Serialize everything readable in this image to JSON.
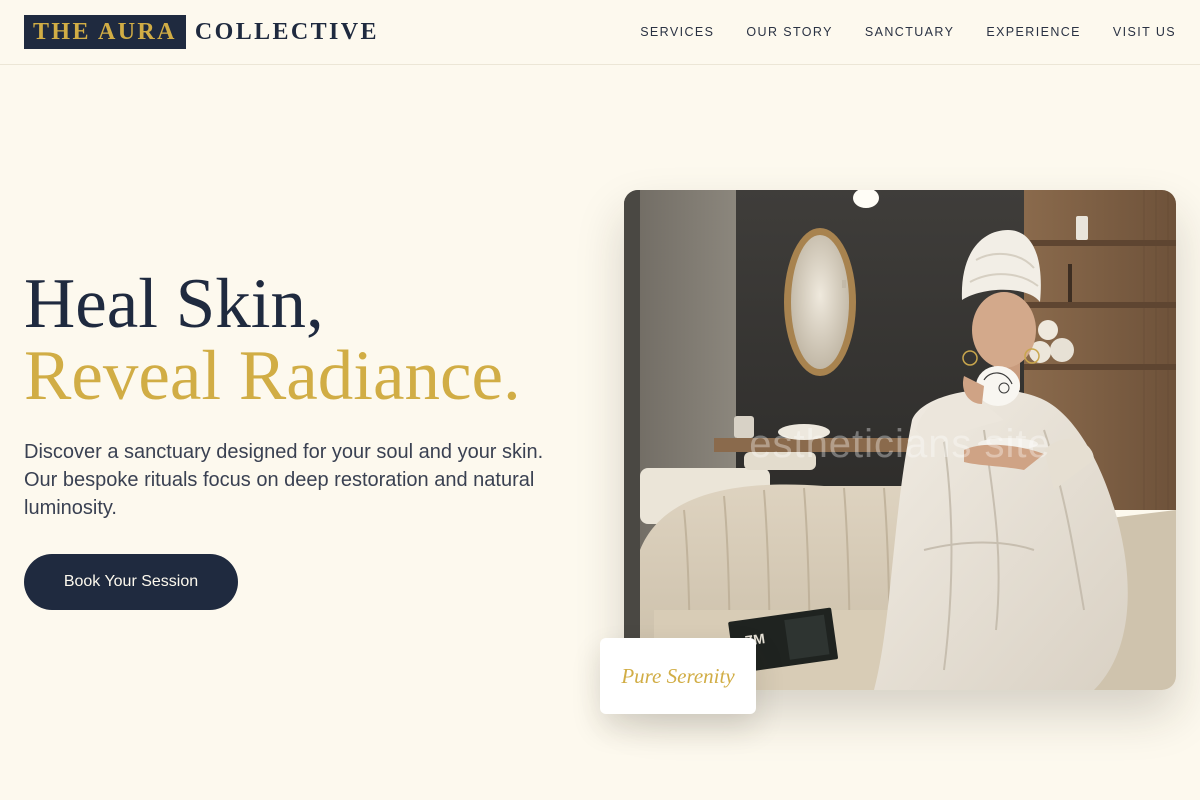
{
  "brand": {
    "mark": "THE AURA",
    "word": "COLLECTIVE"
  },
  "nav": [
    {
      "label": "SERVICES"
    },
    {
      "label": "OUR STORY"
    },
    {
      "label": "SANCTUARY"
    },
    {
      "label": "EXPERIENCE"
    },
    {
      "label": "VISIT US"
    }
  ],
  "hero": {
    "title_line1": "Heal Skin,",
    "title_line2": "Reveal Radiance.",
    "description": "Discover a sanctuary designed for your soul and your skin. Our bespoke rituals focus on deep restoration and natural luminosity.",
    "cta_label": "Book Your Session",
    "image_alt": "Woman in a white robe and towel sipping from a cup in a spa lounge",
    "image_watermark": "estheticians site",
    "badge": "Pure Serenity"
  },
  "colors": {
    "background": "#fdf9ee",
    "navy": "#1f2a3f",
    "gold": "#d1ad45"
  }
}
